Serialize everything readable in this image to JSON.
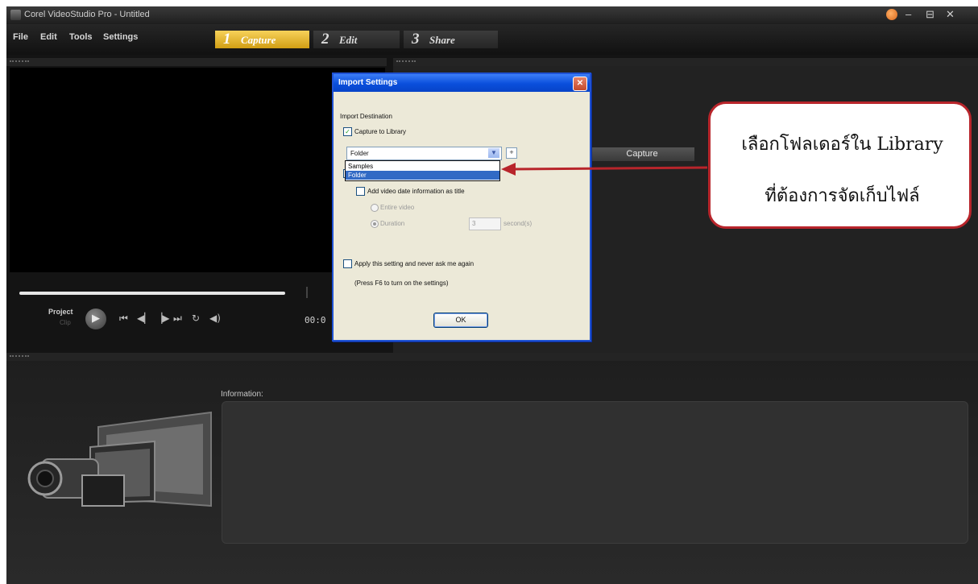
{
  "window": {
    "title": "Corel VideoStudio Pro - Untitled",
    "controls": [
      "–",
      "⊟",
      "✕"
    ]
  },
  "menu": {
    "items": [
      "File",
      "Edit",
      "Tools",
      "Settings"
    ]
  },
  "steps": [
    {
      "num": "1",
      "label": "Capture",
      "active": true
    },
    {
      "num": "2",
      "label": "Edit",
      "active": false
    },
    {
      "num": "3",
      "label": "Share",
      "active": false
    }
  ],
  "player": {
    "project_label": "Project",
    "clip_label": "Clip",
    "timecode": "00:0",
    "controls": [
      "⏮",
      "◀▏",
      "▕▶",
      "⏭",
      "↻",
      "◀)"
    ],
    "playhead_progress": 1.0
  },
  "capture_button": "Capture",
  "information_label": "Information:",
  "dialog": {
    "title": "Import Settings",
    "close": "✕",
    "section": "Import Destination",
    "capture_to_library": {
      "label": "Capture to Library",
      "checked": true
    },
    "folder_select": {
      "value": "Folder",
      "options": [
        "Samples",
        "Folder"
      ],
      "selected": "Folder"
    },
    "plus": "+",
    "add_video_date": {
      "label": "Add video date information as title",
      "checked": false
    },
    "entire_video": "Entire video",
    "duration": {
      "label": "Duration",
      "value": "3",
      "unit": "second(s)"
    },
    "apply_never_ask": {
      "label": "Apply this setting and never ask me again",
      "checked": false
    },
    "hint": "(Press F6 to turn on the settings)",
    "ok": "OK"
  },
  "callout": {
    "line1": "เลือกโฟลเดอร์ใน Library",
    "line2": "ที่ต้องการจัดเก็บไฟล์"
  },
  "colors": {
    "accent_tab": "#e0ad2a",
    "dialog_title": "#0a4fdc",
    "callout_border": "#b8252b"
  }
}
